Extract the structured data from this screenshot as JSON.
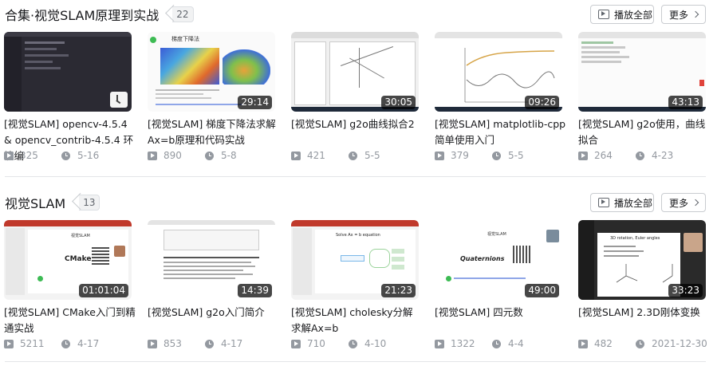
{
  "sections": [
    {
      "title": "合集·视觉SLAM原理到实战",
      "count": "22",
      "play_all": "播放全部",
      "more": "更多",
      "videos": [
        {
          "title": "[视觉SLAM] opencv-4.5.4 & opencv_contrib-4.5.4 环境编",
          "duration": "",
          "plays": "325",
          "date": "5-16"
        },
        {
          "title": "[视觉SLAM] 梯度下降法求解Ax=b原理和代码实战",
          "duration": "29:14",
          "plays": "890",
          "date": "5-8"
        },
        {
          "title": "[视觉SLAM] g2o曲线拟合2",
          "duration": "30:05",
          "plays": "421",
          "date": "5-5"
        },
        {
          "title": "[视觉SLAM] matplotlib-cpp简单使用入门",
          "duration": "09:26",
          "plays": "379",
          "date": "5-5"
        },
        {
          "title": "[视觉SLAM] g2o使用，曲线拟合",
          "duration": "43:13",
          "plays": "264",
          "date": "4-23"
        }
      ]
    },
    {
      "title": "视觉SLAM",
      "count": "13",
      "play_all": "播放全部",
      "more": "更多",
      "videos": [
        {
          "title": "[视觉SLAM] CMake入门到精通实战",
          "duration": "01:01:04",
          "plays": "5211",
          "date": "4-17"
        },
        {
          "title": "[视觉SLAM] g2o入门简介",
          "duration": "14:39",
          "plays": "853",
          "date": "4-17"
        },
        {
          "title": "[视觉SLAM] cholesky分解求解Ax=b",
          "duration": "21:23",
          "plays": "710",
          "date": "4-10"
        },
        {
          "title": "[视觉SLAM] 四元数",
          "duration": "49:00",
          "plays": "1322",
          "date": "4-4"
        },
        {
          "title": "[视觉SLAM] 2.3D刚体变换",
          "duration": "33:23",
          "plays": "482",
          "date": "2021-12-30"
        }
      ]
    }
  ],
  "thumb_text": {
    "gradient_slide_title": "梯度下降法",
    "cmake_slide_title": "CMake",
    "cmake_header": "视觉SLAM",
    "quaternion_header": "视觉SLAM",
    "quaternion_title": "Quaternions",
    "cholesky_title": "Solve Ax = b equation",
    "rotation_title": "3D rotation, Euler angles"
  },
  "colors": {
    "accent": "#00aeec",
    "muted": "#9499a0",
    "text": "#18191c"
  }
}
